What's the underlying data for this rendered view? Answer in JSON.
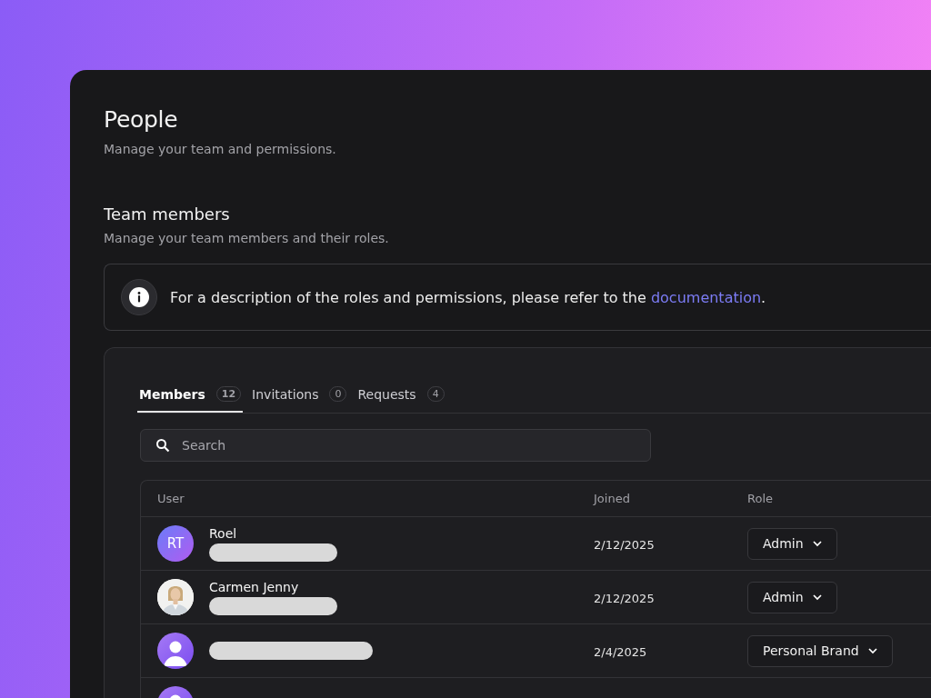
{
  "header": {
    "title": "People",
    "subtitle": "Manage your team and permissions."
  },
  "section": {
    "title": "Team members",
    "subtitle": "Manage your team members and their roles."
  },
  "notice": {
    "text": "For a description of the roles and permissions, please refer to the",
    "link": "documentation",
    "end": "."
  },
  "tabs": [
    {
      "label": "Members",
      "count": "12",
      "selected": true
    },
    {
      "label": "Invitations",
      "count": "0",
      "selected": false
    },
    {
      "label": "Requests",
      "count": "4",
      "selected": false
    }
  ],
  "search": {
    "placeholder": "Search"
  },
  "table": {
    "columns": [
      "User",
      "Joined",
      "Role"
    ],
    "rows": [
      {
        "avatar": {
          "kind": "initials",
          "text": "RT"
        },
        "name": "Roel",
        "joined": "2/12/2025",
        "role": "Admin"
      },
      {
        "name": "Carmen Jenny",
        "joined": "2/12/2025",
        "role": "Admin"
      },
      {
        "avatar": {
          "kind": "icon"
        },
        "joined": "2/4/2025",
        "role": "Personal Brand"
      },
      {
        "avatar": {
          "kind": "icon"
        }
      }
    ]
  }
}
